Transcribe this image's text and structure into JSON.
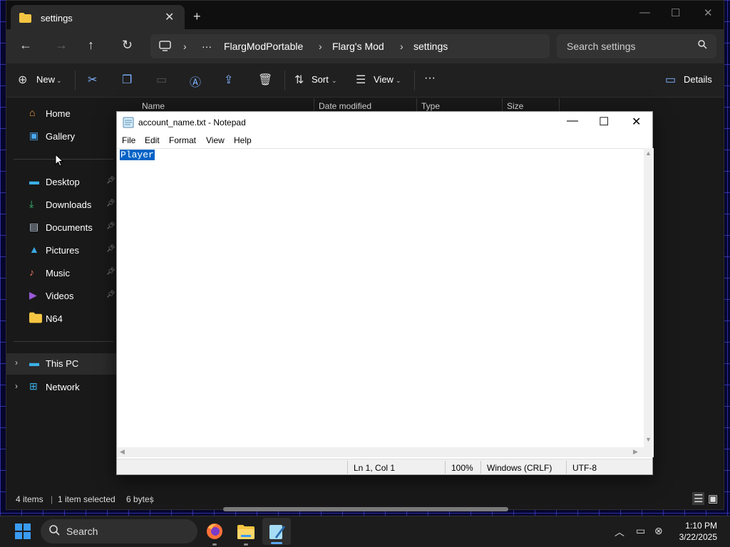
{
  "explorer": {
    "tab_title": "settings",
    "tab_close": "✕",
    "new_tab": "+",
    "window_controls": {
      "minimize": "—",
      "maximize": "☐",
      "close": "✕"
    },
    "breadcrumb": {
      "overflow": "···",
      "items": [
        "FlargModPortable",
        "Flarg's Mod",
        "settings"
      ]
    },
    "search": {
      "placeholder": "Search settings"
    },
    "toolbar": {
      "new_label": "New",
      "sort_label": "Sort",
      "view_label": "View",
      "more_label": "···",
      "details_label": "Details"
    },
    "sidebar": {
      "items": [
        {
          "label": "Home",
          "icon": "home-icon",
          "pinned": false
        },
        {
          "label": "Gallery",
          "icon": "gallery-icon",
          "pinned": false
        },
        {
          "label": "Desktop",
          "icon": "desktop-icon",
          "pinned": true
        },
        {
          "label": "Downloads",
          "icon": "downloads-icon",
          "pinned": true
        },
        {
          "label": "Documents",
          "icon": "documents-icon",
          "pinned": true
        },
        {
          "label": "Pictures",
          "icon": "pictures-icon",
          "pinned": true
        },
        {
          "label": "Music",
          "icon": "music-icon",
          "pinned": true
        },
        {
          "label": "Videos",
          "icon": "videos-icon",
          "pinned": true
        },
        {
          "label": "N64",
          "icon": "folder-icon",
          "pinned": false
        }
      ],
      "this_pc": "This PC",
      "network": "Network"
    },
    "columns": [
      "Name",
      "Date modified",
      "Type",
      "Size"
    ],
    "status": {
      "items": "4 items",
      "selected": "1 item selected",
      "size": "6 bytes"
    }
  },
  "notepad": {
    "title": "account_name.txt - Notepad",
    "menu": [
      "File",
      "Edit",
      "Format",
      "View",
      "Help"
    ],
    "content": "Player",
    "status": {
      "position": "Ln 1, Col 1",
      "zoom": "100%",
      "line_ending": "Windows (CRLF)",
      "encoding": "UTF-8"
    }
  },
  "taskbar": {
    "search_placeholder": "Search",
    "time": "1:10 PM",
    "date": "3/22/2025"
  },
  "colors": {
    "accent": "#0063c6",
    "explorer_bg": "#191919",
    "taskbar_bg": "#1c1c1c",
    "start_blue": "#3a9bf2"
  }
}
